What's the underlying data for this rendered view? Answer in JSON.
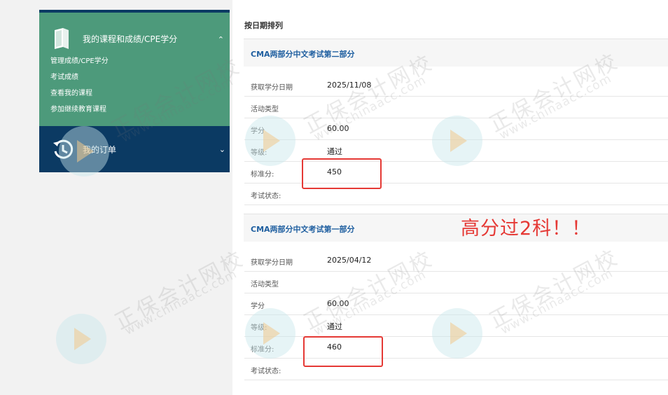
{
  "sidebar": {
    "courses_title": "我的课程和成绩/CPE学分",
    "links": [
      "管理成绩/CPE学分",
      "考试成绩",
      "查看我的课程",
      "参加继续教育课程"
    ],
    "orders_title": "我的订单",
    "icons": {
      "courses": "book-icon",
      "orders": "history-icon",
      "collapse": "chevron-up-icon",
      "expand": "chevron-down-icon"
    }
  },
  "main": {
    "sort_label": "按日期排列",
    "records": [
      {
        "title": "CMA两部分中文考试第二部分",
        "rows": [
          {
            "label": "获取学分日期",
            "value": "2025/11/08"
          },
          {
            "label": "活动类型",
            "value": ""
          },
          {
            "label": "学分",
            "value": "60.00"
          },
          {
            "label": "等级:",
            "value": "通过"
          },
          {
            "label": "标准分:",
            "value": "450"
          },
          {
            "label": "考试状态:",
            "value": ""
          }
        ]
      },
      {
        "title": "CMA两部分中文考试第一部分",
        "rows": [
          {
            "label": "获取学分日期",
            "value": "2025/04/12"
          },
          {
            "label": "活动类型",
            "value": ""
          },
          {
            "label": "学分",
            "value": "60.00"
          },
          {
            "label": "等级:",
            "value": "通过"
          },
          {
            "label": "标准分:",
            "value": "460"
          },
          {
            "label": "考试状态:",
            "value": ""
          }
        ]
      }
    ]
  },
  "annotation": "高分过2科！！",
  "watermark": {
    "cn": "正保会计网校",
    "en": "www.chinaacc.com"
  },
  "colors": {
    "sidebar_green": "#4d9a7b",
    "sidebar_navy": "#0b3a63",
    "title_blue": "#1f5fa0",
    "highlight_red": "#e53935"
  }
}
